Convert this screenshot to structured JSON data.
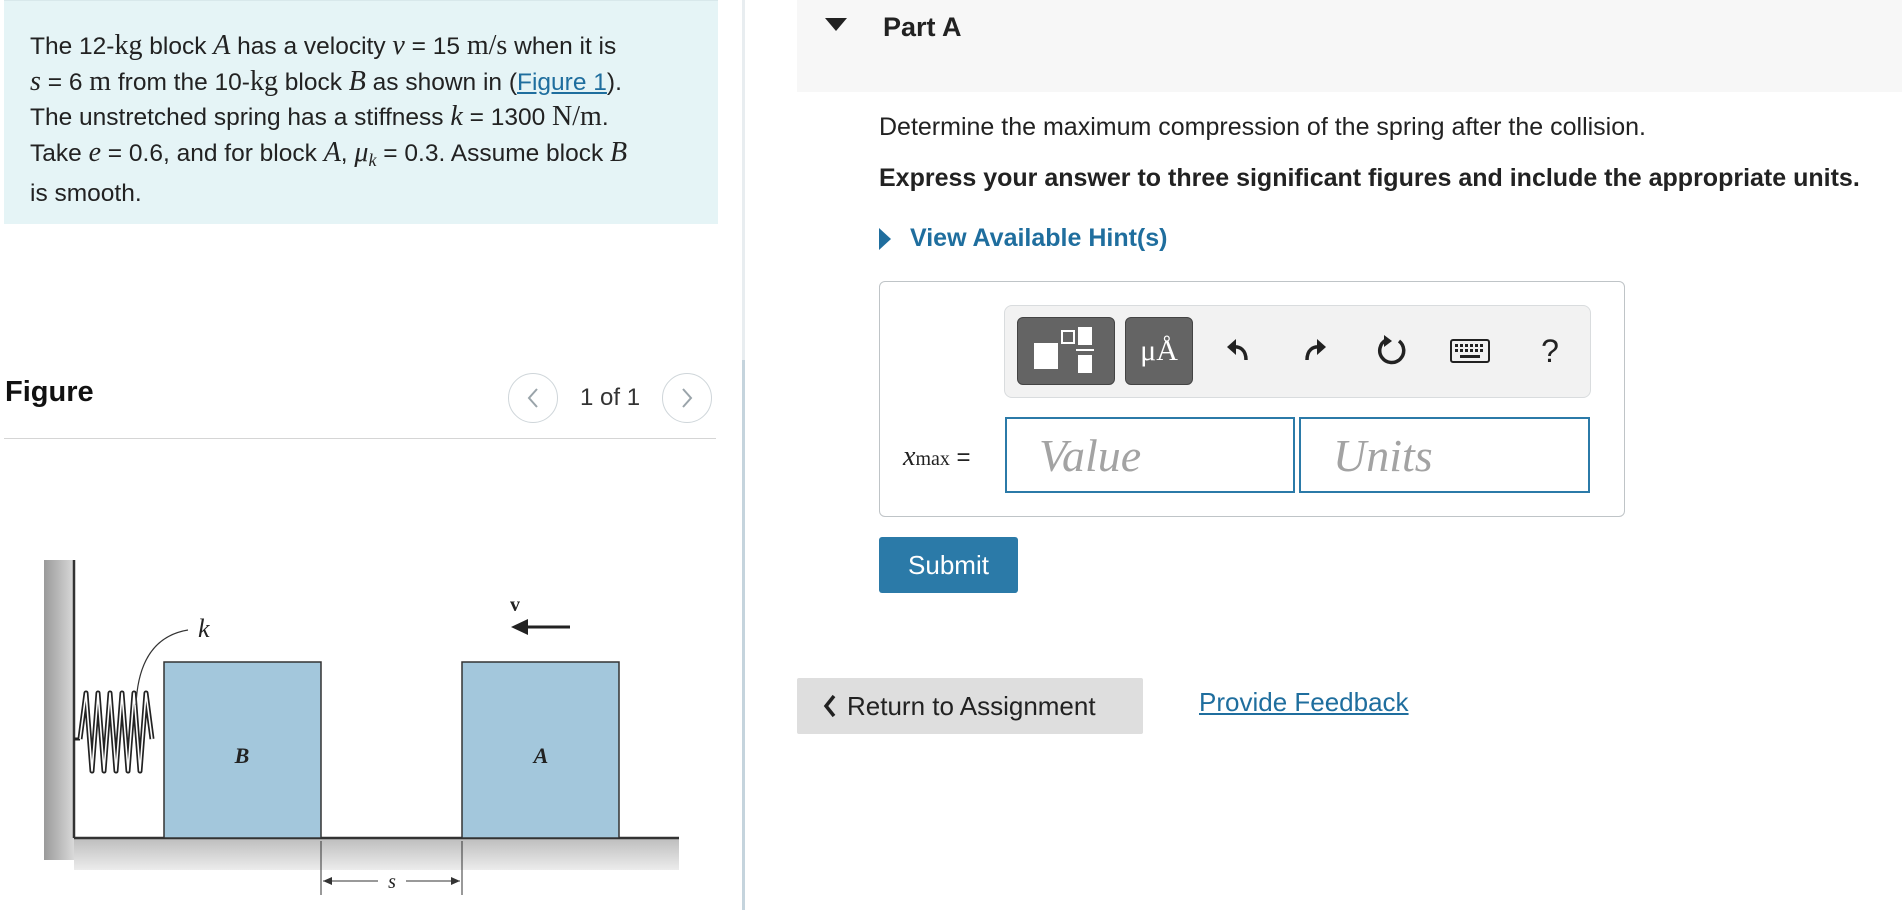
{
  "problem": {
    "p1": "The 12-",
    "kg": "kg",
    "p2": " block ",
    "A": "A",
    "p3": " has a velocity ",
    "v": "v",
    "p4": " = 15 ",
    "ms": "m/s",
    "p5": " when it is",
    "s": "s",
    "p6": " = 6 ",
    "m": "m",
    "p7": " from the 10-",
    "p8": " block ",
    "B": "B",
    "p9": " as shown in (",
    "figure_link": "Figure 1",
    "p10": ").",
    "p11": "The unstretched spring has a stiffness ",
    "k": "k",
    "p12": " = 1300 ",
    "Nm": "N/m",
    "p13": ".",
    "p14": "Take ",
    "e": "e",
    "p15": " = 0.6, and for block ",
    "p16": ", ",
    "mu": "μ",
    "mu_sub": "k",
    "p17": " = 0.3. Assume block ",
    "p18": "is smooth."
  },
  "figure": {
    "title": "Figure",
    "pager": "1 of 1",
    "labels": {
      "spring": "k",
      "block_b": "B",
      "block_a": "A",
      "velocity": "v",
      "distance": "s"
    }
  },
  "part": {
    "title": "Part A"
  },
  "question": "Determine the maximum compression of the spring after the collision.",
  "instructions": "Express your answer to three significant figures and include the appropriate units.",
  "hint": {
    "label": "View Available Hint(s)"
  },
  "toolbar": {
    "units_label": "μÅ",
    "help_label": "?"
  },
  "answer": {
    "variable": "x",
    "variable_sub": "max",
    "equals": "=",
    "value_placeholder": "Value",
    "units_placeholder": "Units"
  },
  "buttons": {
    "submit": "Submit",
    "return": "Return to Assignment",
    "feedback": "Provide Feedback"
  },
  "colors": {
    "accent": "#2b7aa8",
    "link": "#1f6e9e",
    "problem_bg": "#e5f4f6",
    "block_fill": "#a3c7dc"
  }
}
